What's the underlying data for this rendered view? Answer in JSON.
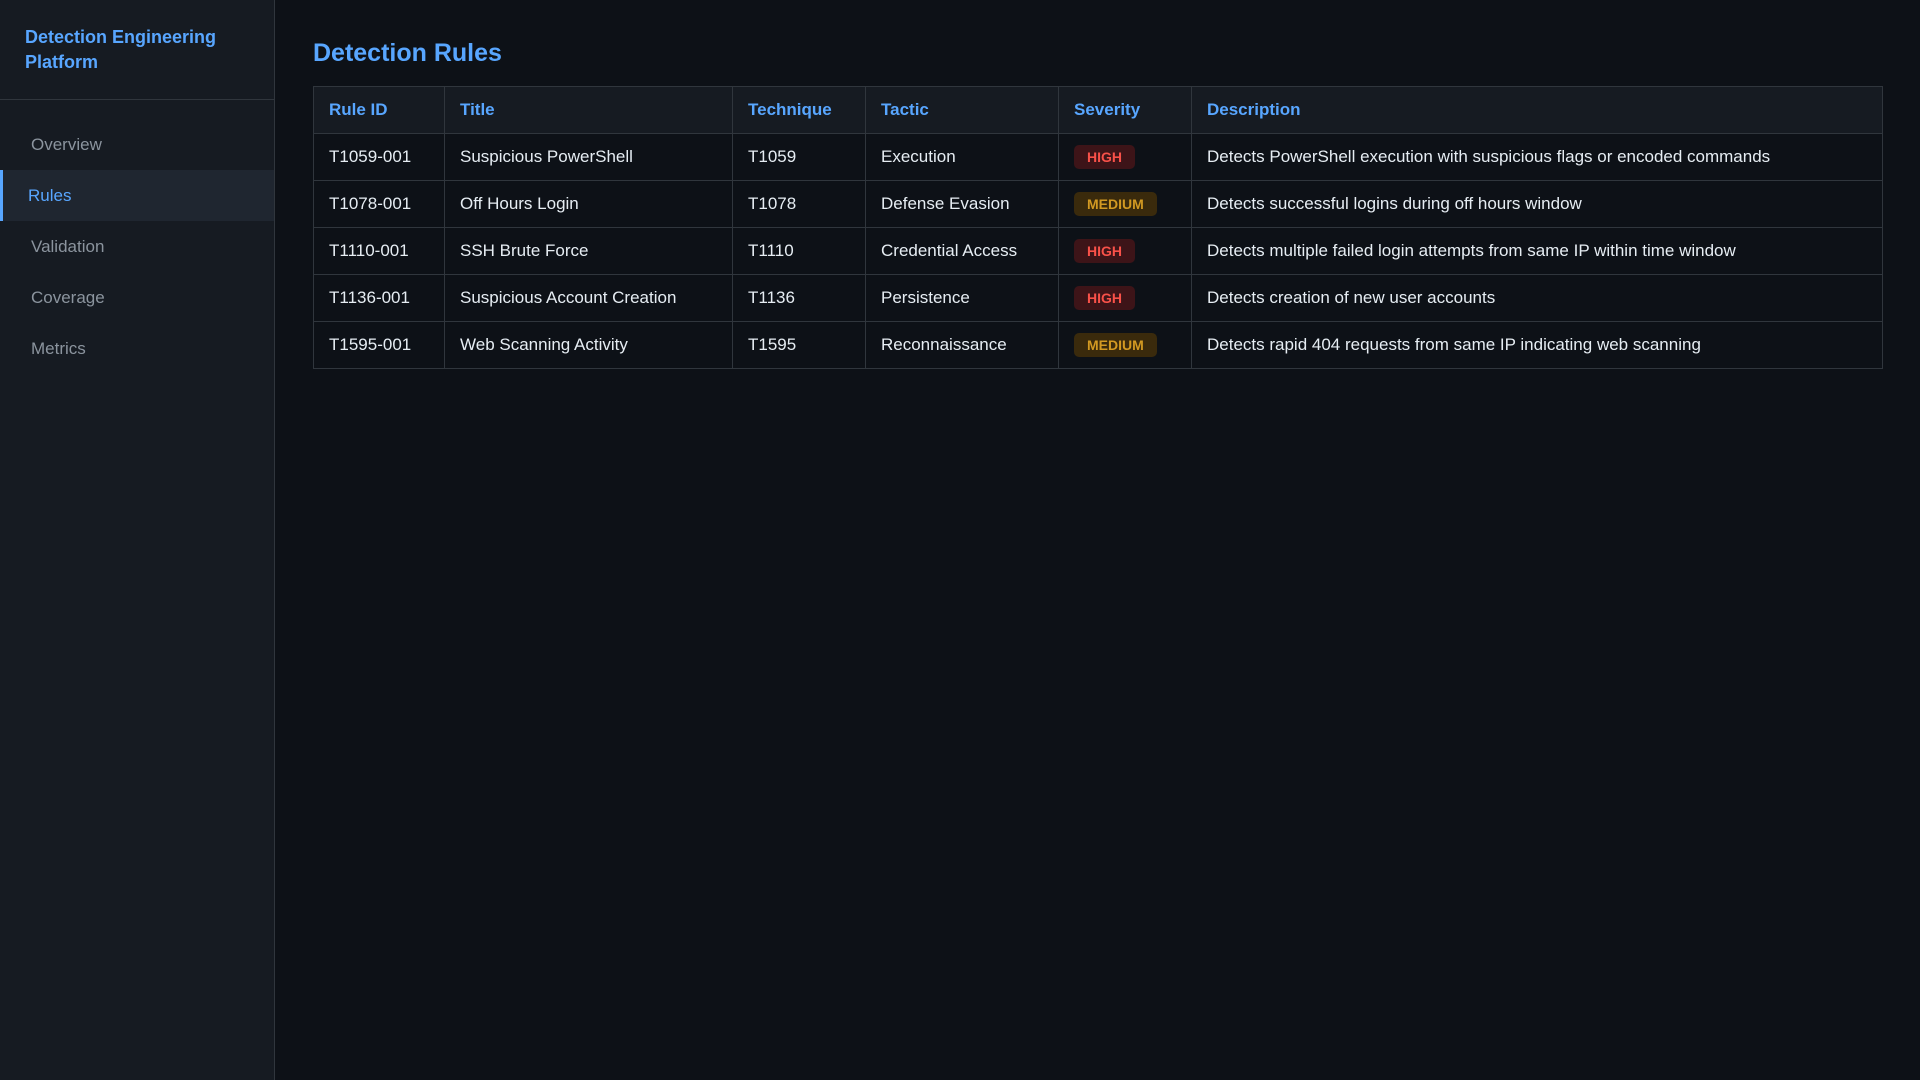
{
  "sidebar": {
    "brand": "Detection Engineering Platform",
    "items": [
      {
        "label": "Overview",
        "active": false
      },
      {
        "label": "Rules",
        "active": true
      },
      {
        "label": "Validation",
        "active": false
      },
      {
        "label": "Coverage",
        "active": false
      },
      {
        "label": "Metrics",
        "active": false
      }
    ]
  },
  "main": {
    "title": "Detection Rules",
    "table": {
      "headers": [
        "Rule ID",
        "Title",
        "Technique",
        "Tactic",
        "Severity",
        "Description"
      ],
      "rows": [
        {
          "id": "T1059-001",
          "title": "Suspicious PowerShell",
          "technique": "T1059",
          "tactic": "Execution",
          "severity": "HIGH",
          "description": "Detects PowerShell execution with suspicious flags or encoded commands"
        },
        {
          "id": "T1078-001",
          "title": "Off Hours Login",
          "technique": "T1078",
          "tactic": "Defense Evasion",
          "severity": "MEDIUM",
          "description": "Detects successful logins during off hours window"
        },
        {
          "id": "T1110-001",
          "title": "SSH Brute Force",
          "technique": "T1110",
          "tactic": "Credential Access",
          "severity": "HIGH",
          "description": "Detects multiple failed login attempts from same IP within time window"
        },
        {
          "id": "T1136-001",
          "title": "Suspicious Account Creation",
          "technique": "T1136",
          "tactic": "Persistence",
          "severity": "HIGH",
          "description": "Detects creation of new user accounts"
        },
        {
          "id": "T1595-001",
          "title": "Web Scanning Activity",
          "technique": "T1595",
          "tactic": "Reconnaissance",
          "severity": "MEDIUM",
          "description": "Detects rapid 404 requests from same IP indicating web scanning"
        }
      ]
    }
  },
  "colors": {
    "accent": "#58a6ff",
    "background": "#0d1117",
    "sidebar": "#161b22",
    "high": "#f85149",
    "medium": "#d29922"
  }
}
